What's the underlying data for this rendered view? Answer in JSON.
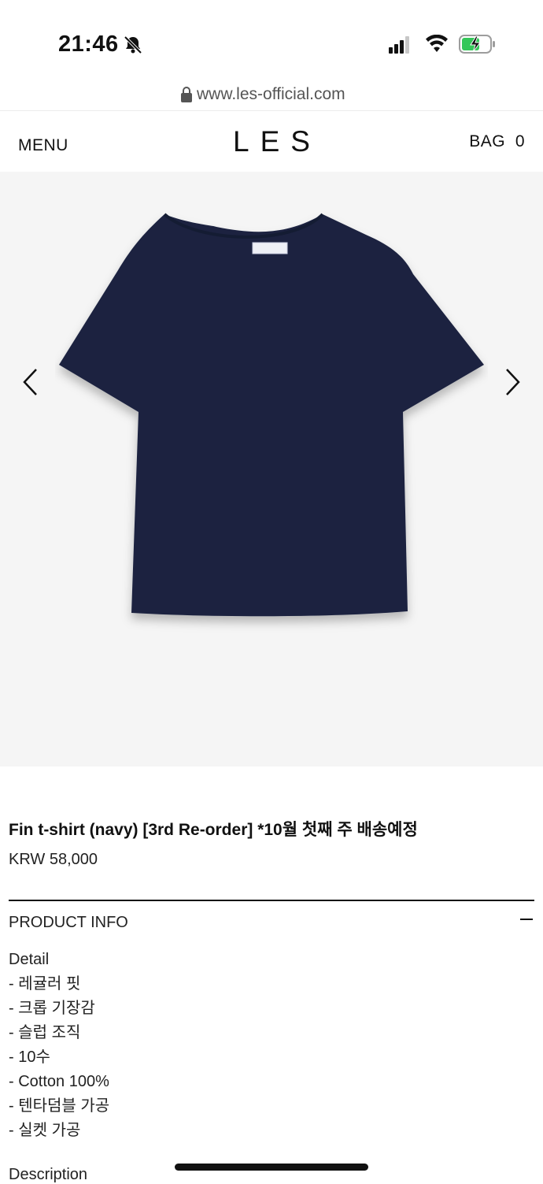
{
  "status_bar": {
    "time": "21:46",
    "icons": [
      "bell-slash-icon",
      "signal-icon",
      "wifi-icon",
      "battery-charging-icon"
    ]
  },
  "browser": {
    "url": "www.les-official.com",
    "lock_icon": "lock-icon"
  },
  "header": {
    "menu_label": "MENU",
    "logo": "LES",
    "bag_label": "BAG",
    "bag_count": "0"
  },
  "gallery": {
    "prev_icon": "chevron-left-icon",
    "next_icon": "chevron-right-icon",
    "image_subject": "navy t-shirt"
  },
  "product": {
    "title": "Fin t-shirt (navy) [3rd Re-order] *10월 첫째 주 배송예정",
    "price": "KRW 58,000"
  },
  "product_info": {
    "header": "PRODUCT INFO",
    "toggle_icon": "minus-icon",
    "detail_heading": "Detail",
    "details": [
      "- 레귤러 핏",
      "- 크롭 기장감",
      "- 슬럽 조직",
      "- 10수",
      "- Cotton 100%",
      "- 텐타덤블 가공",
      "- 실켓 가공"
    ],
    "description_heading": "Description"
  },
  "colors": {
    "background": "#ffffff",
    "gallery_bg": "#f5f5f5",
    "shirt_navy": "#1b2440",
    "battery_green": "#34c759"
  }
}
